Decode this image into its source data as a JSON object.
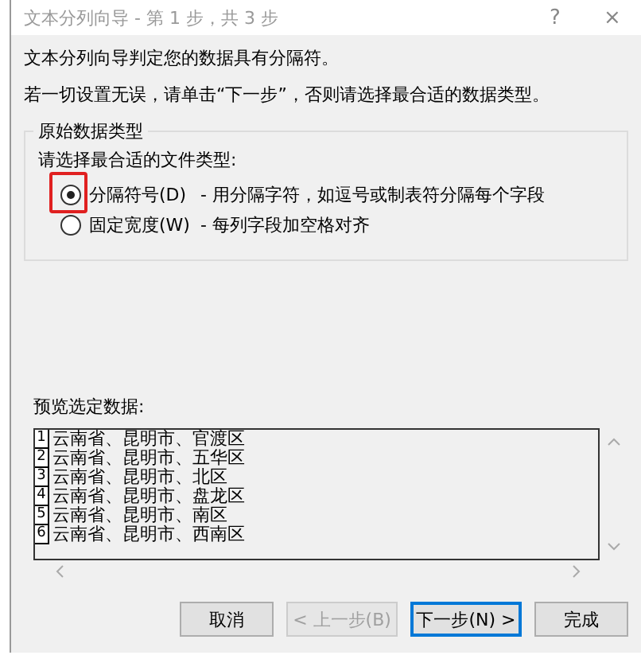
{
  "window": {
    "title": "文本分列向导 - 第 1 步，共 3 步",
    "help": "?",
    "close": "×"
  },
  "intro": [
    "文本分列向导判定您的数据具有分隔符。",
    "若一切设置无误，请单击“下一步”，否则请选择最合适的数据类型。"
  ],
  "group": {
    "title": "原始数据类型",
    "prompt": "请选择最合适的文件类型:",
    "options": [
      {
        "label": "分隔符号(D)",
        "description": "- 用分隔字符，如逗号或制表符分隔每个字段",
        "selected": true,
        "highlighted": true
      },
      {
        "label": "固定宽度(W)",
        "description": "- 每列字段加空格对齐",
        "selected": false,
        "highlighted": false
      }
    ]
  },
  "preview": {
    "label": "预览选定数据:",
    "rows": [
      {
        "number": "1",
        "text": "云南省、昆明市、官渡区"
      },
      {
        "number": "2",
        "text": "云南省、昆明市、五华区"
      },
      {
        "number": "3",
        "text": "云南省、昆明市、北区"
      },
      {
        "number": "4",
        "text": "云南省、昆明市、盘龙区"
      },
      {
        "number": "5",
        "text": "云南省、昆明市、南区"
      },
      {
        "number": "6",
        "text": "云南省、昆明市、西南区"
      }
    ]
  },
  "buttons": [
    {
      "label": "取消",
      "disabled": false,
      "default": false
    },
    {
      "label": "< 上一步(B)",
      "disabled": true,
      "default": false
    },
    {
      "label": "下一步(N) >",
      "disabled": false,
      "default": true
    },
    {
      "label": "完成",
      "disabled": false,
      "default": false
    }
  ]
}
